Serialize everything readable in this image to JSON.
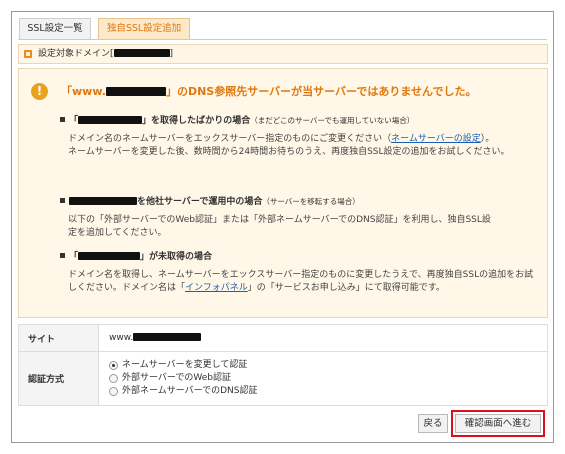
{
  "tabs": [
    {
      "label": "SSL設定一覧",
      "active": false
    },
    {
      "label": "独自SSL設定追加",
      "active": true
    }
  ],
  "target": {
    "label_prefix": "設定対象ドメイン[",
    "label_suffix": "]"
  },
  "warning": {
    "icon": "!",
    "title_prefix": "「www.",
    "title_suffix": "」のDNS参照先サーバーが当サーバーではありませんでした。",
    "case1": {
      "title_prefix": "「",
      "title_suffix": "」を取得したばかりの場合",
      "note": "（まだどこのサーバーでも運用していない場合）",
      "text_before": "ドメイン名のネームサーバーをエックスサーバー指定のものにご変更ください（",
      "link": "ネームサーバーの設定",
      "text_after": "）。",
      "text2": "ネームサーバーを変更した後、数時間から24時間お待ちのうえ、再度独自SSL設定の追加をお試しください。"
    },
    "case2": {
      "title_suffix": "を他社サーバーで運用中の場合",
      "note": "（サーバーを移転する場合）",
      "text": "以下の「外部サーバーでのWeb認証」または「外部ネームサーバーでのDNS認証」を利用し、独自SSL設定を追加してください。"
    },
    "case3": {
      "title_prefix": "「",
      "title_suffix": "」が未取得の場合",
      "text1": "ドメイン名を取得し、ネームサーバーをエックスサーバー指定のものに変更したうえで、再度独自SSLの追加をお試しください。ドメイン名は「",
      "link": "インフォパネル",
      "text2": "」の「サービスお申し込み」にて取得可能です。"
    }
  },
  "form": {
    "site_label": "サイト",
    "site_value_prefix": "www.",
    "auth_label": "認証方式",
    "auth_options": [
      {
        "label": "ネームサーバーを変更して認証",
        "checked": true
      },
      {
        "label": "外部サーバーでのWeb認証",
        "checked": false
      },
      {
        "label": "外部ネームサーバーでのDNS認証",
        "checked": false
      }
    ]
  },
  "buttons": {
    "back": "戻る",
    "next": "確認画面へ進む"
  },
  "colors": {
    "accent": "#e07810",
    "highlight_outline": "#d9111a",
    "link": "#1a5fb4"
  }
}
